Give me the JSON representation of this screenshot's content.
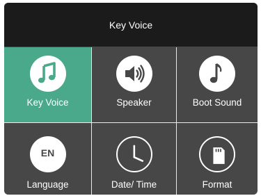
{
  "header": {
    "title": "Key Voice"
  },
  "tiles": [
    {
      "label": "Key Voice",
      "icon": "music-note-icon",
      "active": true
    },
    {
      "label": "Speaker",
      "icon": "speaker-icon",
      "active": false
    },
    {
      "label": "Boot Sound",
      "icon": "single-note-icon",
      "active": false
    },
    {
      "label": "Language",
      "icon": "language-en-icon",
      "icon_text": "EN",
      "active": false
    },
    {
      "label": "Date/ Time",
      "icon": "clock-icon",
      "active": false
    },
    {
      "label": "Format",
      "icon": "sd-card-icon",
      "active": false
    }
  ],
  "colors": {
    "header_bg": "#1b1b1b",
    "tile_bg": "#474747",
    "active_tile_bg": "#4aa98a",
    "divider": "#ececec",
    "text": "#ffffff"
  }
}
